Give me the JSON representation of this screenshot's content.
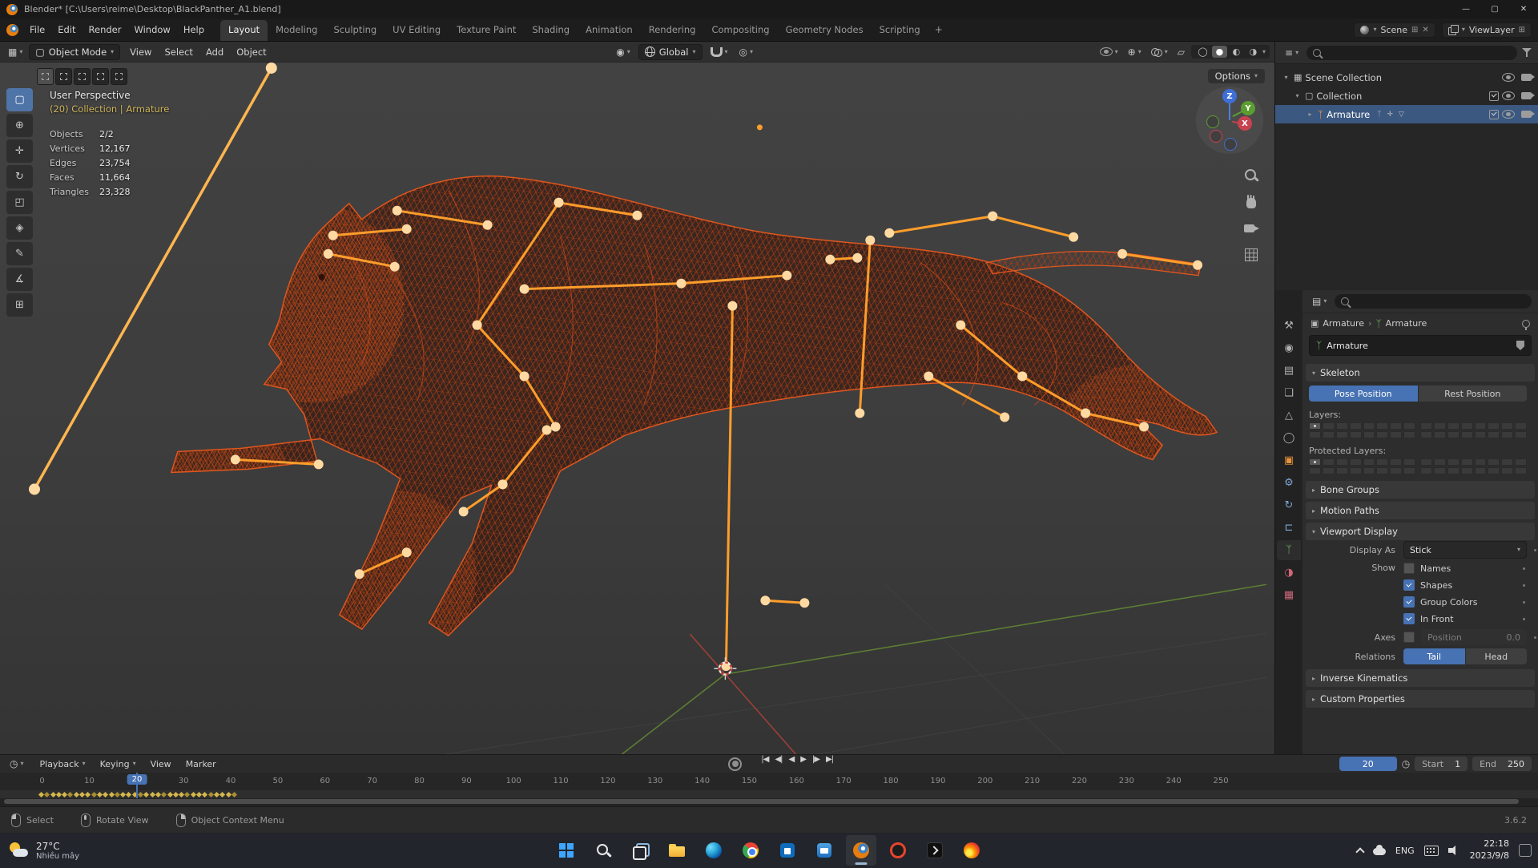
{
  "window": {
    "title": "Blender* [C:\\Users\\reime\\Desktop\\BlackPanther_A1.blend]",
    "controls": {
      "minimize": "—",
      "maximize": "▢",
      "close": "✕"
    }
  },
  "icons": {
    "chevron": "▾",
    "editor_grid": "▦",
    "mode_object": "▢",
    "pivot": "◉",
    "proportional": "◎",
    "gizmo": "⊕",
    "xray": "▱",
    "shade_wire": "◯",
    "shade_solid": "●",
    "shade_material": "◐",
    "shade_render": "◑",
    "clock": "◷",
    "plus_box": "⊞",
    "close": "✕",
    "expanded": "▾",
    "collapsed": "▸",
    "arrow_right": "›",
    "outliner": "≡",
    "properties": "▤",
    "object_box": "▣",
    "armature": "ᛉ"
  },
  "topbar": {
    "menus": [
      "File",
      "Edit",
      "Render",
      "Window",
      "Help"
    ],
    "workspaces": [
      {
        "label": "Layout",
        "active": true
      },
      {
        "label": "Modeling"
      },
      {
        "label": "Sculpting"
      },
      {
        "label": "UV Editing"
      },
      {
        "label": "Texture Paint"
      },
      {
        "label": "Shading"
      },
      {
        "label": "Animation"
      },
      {
        "label": "Rendering"
      },
      {
        "label": "Compositing"
      },
      {
        "label": "Geometry Nodes"
      },
      {
        "label": "Scripting"
      }
    ],
    "add_workspace": "+",
    "scene": {
      "label": "Scene"
    },
    "view_layer": {
      "label": "ViewLayer"
    }
  },
  "viewport_header": {
    "mode": "Object Mode",
    "menus": [
      "View",
      "Select",
      "Add",
      "Object"
    ],
    "orientation": "Global",
    "options": "Options"
  },
  "viewport": {
    "overlay": {
      "view": "User Perspective",
      "context": "(20) Collection | Armature",
      "stats": [
        {
          "label": "Objects",
          "value": "2/2"
        },
        {
          "label": "Vertices",
          "value": "12,167"
        },
        {
          "label": "Edges",
          "value": "23,754"
        },
        {
          "label": "Faces",
          "value": "11,664"
        },
        {
          "label": "Triangles",
          "value": "23,328"
        }
      ]
    },
    "gizmo": {
      "z": "Z",
      "y": "Y",
      "x": "X"
    },
    "select_modes": [
      {
        "name": "select-mode-new-button",
        "active": true
      },
      {
        "name": "select-mode-extend-button"
      },
      {
        "name": "select-mode-subtract-button"
      },
      {
        "name": "select-mode-invert-button"
      },
      {
        "name": "select-mode-intersect-button"
      }
    ]
  },
  "toolbar": {
    "tools": [
      {
        "name": "select-box-tool",
        "glyph": "▢",
        "active": true
      },
      {
        "name": "cursor-tool",
        "glyph": "⊕"
      },
      {
        "name": "move-tool",
        "glyph": "✛"
      },
      {
        "name": "rotate-tool",
        "glyph": "↻"
      },
      {
        "name": "scale-tool",
        "glyph": "◰"
      },
      {
        "name": "transform-tool",
        "glyph": "◈"
      },
      {
        "name": "annotate-tool",
        "glyph": "✎"
      },
      {
        "name": "measure-tool",
        "glyph": "∡"
      },
      {
        "name": "add-cube-tool",
        "glyph": "⊞"
      }
    ]
  },
  "outliner": {
    "rows": [
      {
        "name": "outliner-row-scene-collection",
        "arrow": "▾",
        "icon": "▦",
        "label": "Scene Collection",
        "minis": "",
        "cls": "lvl0"
      },
      {
        "name": "outliner-row-collection",
        "arrow": "▾",
        "icon": "▢",
        "label": "Collection",
        "minis": "",
        "cls": "lvl1 has-check"
      },
      {
        "name": "outliner-row-armature",
        "arrow": "▸",
        "icon": "ᛉ",
        "label": "Armature",
        "minis": "ᛉ ✛ ▽",
        "cls": "lvl2 selected armature has-check"
      }
    ]
  },
  "properties": {
    "tabs": [
      {
        "name": "tab-tool",
        "glyph": "⚒",
        "cls": "c-gray"
      },
      {
        "name": "tab-render",
        "glyph": "◉",
        "cls": "c-gray"
      },
      {
        "name": "tab-output",
        "glyph": "▤",
        "cls": "c-gray"
      },
      {
        "name": "tab-view-layer",
        "glyph": "❏",
        "cls": "c-gray"
      },
      {
        "name": "tab-scene",
        "glyph": "△",
        "cls": "c-gray"
      },
      {
        "name": "tab-world",
        "glyph": "◯",
        "cls": "c-gray"
      },
      {
        "name": "tab-object",
        "glyph": "▣",
        "cls": "c-orange"
      },
      {
        "name": "tab-modifiers",
        "glyph": "⚙",
        "cls": "c-blue"
      },
      {
        "name": "tab-physics",
        "glyph": "↻",
        "cls": "c-blue"
      },
      {
        "name": "tab-constraints",
        "glyph": "⊏",
        "cls": "c-blue"
      },
      {
        "name": "tab-data",
        "glyph": "ᛉ",
        "cls": "c-green",
        "active": true
      },
      {
        "name": "tab-material",
        "glyph": "◑",
        "cls": "c-red"
      },
      {
        "name": "tab-texture",
        "glyph": "▦",
        "cls": "c-red"
      }
    ],
    "breadcrumb": {
      "object": "Armature",
      "data": "Armature"
    },
    "name_value": "Armature",
    "skeleton": {
      "title": "Skeleton",
      "pose": "Pose Position",
      "rest": "Rest Position",
      "layers": "Layers:",
      "protected": "Protected Layers:"
    },
    "collapsed_mid": [
      "Bone Groups",
      "Motion Paths"
    ],
    "viewport_display": {
      "title": "Viewport Display",
      "display_as_label": "Display As",
      "display_as": "Stick",
      "show_label": "Show",
      "toggles": [
        {
          "label": "Names",
          "checked": false
        },
        {
          "label": "Shapes",
          "checked": true
        },
        {
          "label": "Group Colors",
          "checked": true
        },
        {
          "label": "In Front",
          "checked": true
        }
      ],
      "axes_label": "Axes",
      "position_label": "Position",
      "position_value": "0.0",
      "relations_label": "Relations",
      "tail": "Tail",
      "head": "Head"
    },
    "collapsed_bottom": [
      "Inverse Kinematics",
      "Custom Properties"
    ]
  },
  "timeline": {
    "menus": [
      {
        "label": "Playback",
        "cls": "has-chev"
      },
      {
        "label": "Keying",
        "cls": "has-chev"
      },
      {
        "label": "View"
      },
      {
        "label": "Marker"
      }
    ],
    "transport": [
      {
        "name": "jump-start-button",
        "glyph": "|◀"
      },
      {
        "name": "prev-keyframe-button",
        "glyph": "◀|"
      },
      {
        "name": "play-reverse-button",
        "glyph": "◀"
      },
      {
        "name": "play-button",
        "glyph": "▶"
      },
      {
        "name": "next-keyframe-button",
        "glyph": "|▶"
      },
      {
        "name": "jump-end-button",
        "glyph": "▶|"
      }
    ],
    "frame": "20",
    "start_label": "Start",
    "start_value": "1",
    "end_label": "End",
    "end_value": "250",
    "ticks": [
      "0",
      "10",
      "20",
      "30",
      "40",
      "50",
      "60",
      "70",
      "80",
      "90",
      "100",
      "110",
      "120",
      "130",
      "140",
      "150",
      "160",
      "170",
      "180",
      "190",
      "200",
      "210",
      "220",
      "230",
      "240",
      "250"
    ],
    "playhead": "20",
    "keyframe_range": {
      "from": 0,
      "to": 40,
      "count": 34
    }
  },
  "status_bar": {
    "hints": [
      {
        "name": "status-hint-select",
        "label": "Select",
        "cls": "left"
      },
      {
        "name": "status-hint-rotate-view",
        "label": "Rotate View",
        "cls": "middle"
      },
      {
        "name": "status-hint-context-menu",
        "label": "Object Context Menu",
        "cls": "right"
      }
    ],
    "version": "3.6.2"
  },
  "taskbar": {
    "weather_temp": "27°C",
    "weather_desc": "Nhiều mây",
    "apps": [
      {
        "name": "start-button",
        "cls": "start"
      },
      {
        "name": "search-button",
        "cls": "search"
      },
      {
        "name": "task-view-button",
        "cls": "taskview"
      },
      {
        "name": "file-explorer-icon",
        "cls": "explorer"
      },
      {
        "name": "edge-icon",
        "cls": "edge"
      },
      {
        "name": "chrome-icon",
        "cls": "chrome"
      },
      {
        "name": "store-icon",
        "cls": "store"
      },
      {
        "name": "mail-icon",
        "cls": "mailapp"
      },
      {
        "name": "blender-icon",
        "cls": "blender",
        "active": true
      },
      {
        "name": "red-ring-app-icon",
        "cls": "redapp"
      },
      {
        "name": "terminal-icon",
        "cls": "terminal"
      },
      {
        "name": "firefox-icon",
        "cls": "firefox"
      }
    ],
    "tray": {
      "lang": "ENG",
      "time": "22:18",
      "date": "2023/9/8"
    }
  }
}
